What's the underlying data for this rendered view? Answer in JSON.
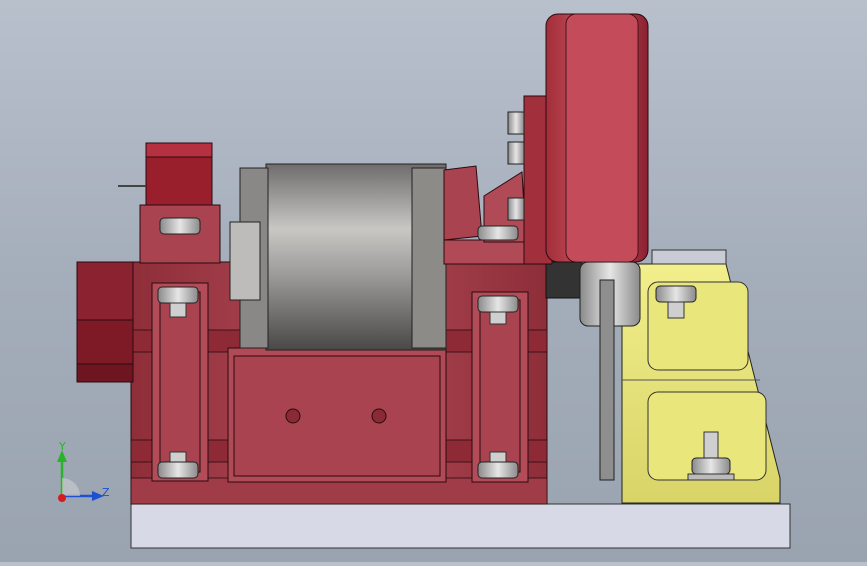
{
  "viewport": {
    "background_top": "#b8c0cc",
    "background_bottom": "#9aa3b0"
  },
  "colors": {
    "frame_red": "#a8434f",
    "frame_red_dark": "#7a1e28",
    "frame_red_light": "#c86470",
    "motor_grey": "#9c9a98",
    "bracket_yellow": "#e3e07a",
    "bracket_yellow_dark": "#b9b64a",
    "base_plate": "#d6d8e6",
    "axis_y": "#28b428",
    "axis_z": "#1e50d2",
    "axis_origin": "#d21e1e"
  },
  "triad": {
    "y_label": "Y",
    "z_label": "Z"
  }
}
